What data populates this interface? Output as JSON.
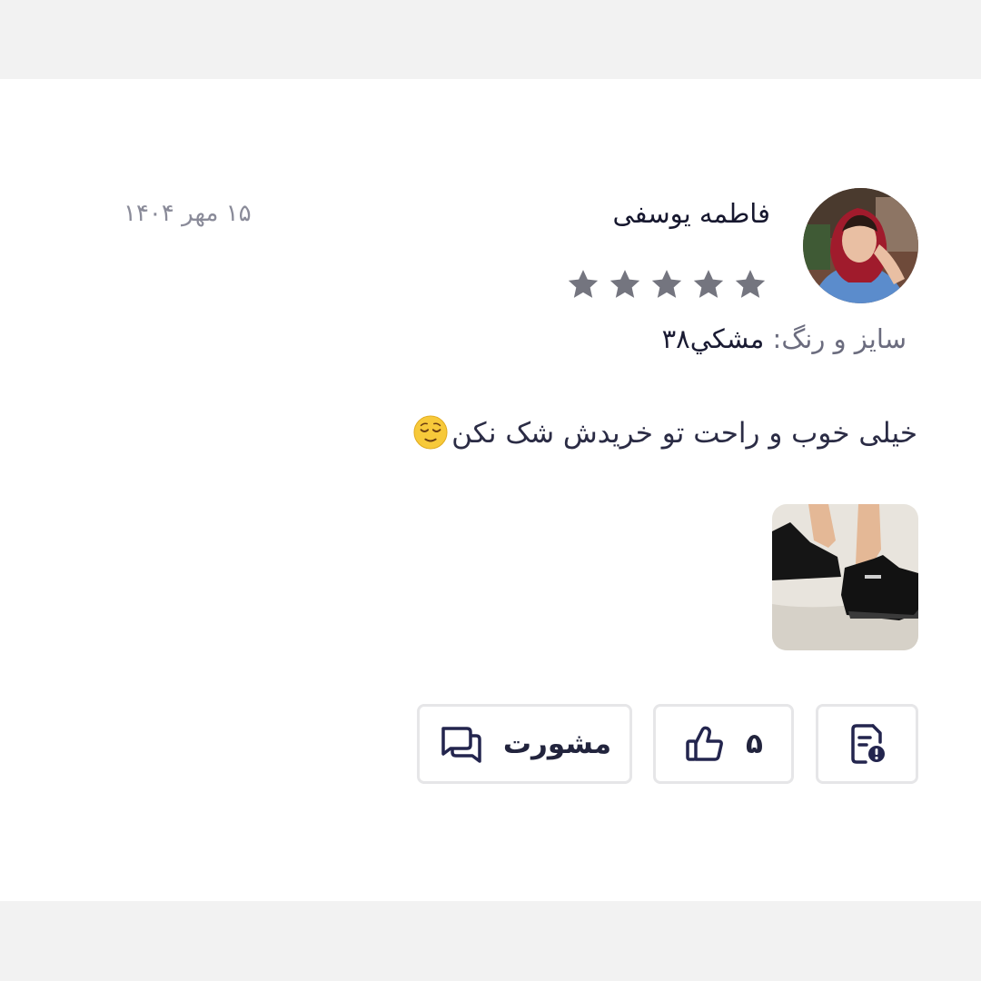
{
  "review": {
    "user_name": "فاطمه یوسفی",
    "date": "۱۵ مهر ۱۴۰۴",
    "rating": 5,
    "variant_label": "سایز و رنگ:",
    "variant_value": "مشکي۳۸",
    "comment": "خیلی خوب و راحت تو خریدش شک نکن"
  },
  "actions": {
    "like_count": "۵",
    "discuss_label": "مشورت"
  },
  "icons": {
    "star": "star-icon",
    "emoji": "relieved-face-emoji",
    "report": "report-document-icon",
    "like": "thumbs-up-icon",
    "discuss": "chat-bubbles-icon"
  },
  "colors": {
    "star": "#74757f",
    "text_primary": "#17182f",
    "text_muted": "#8a8b99",
    "border": "#e6e6e8",
    "page_bg": "#f2f2f2"
  }
}
